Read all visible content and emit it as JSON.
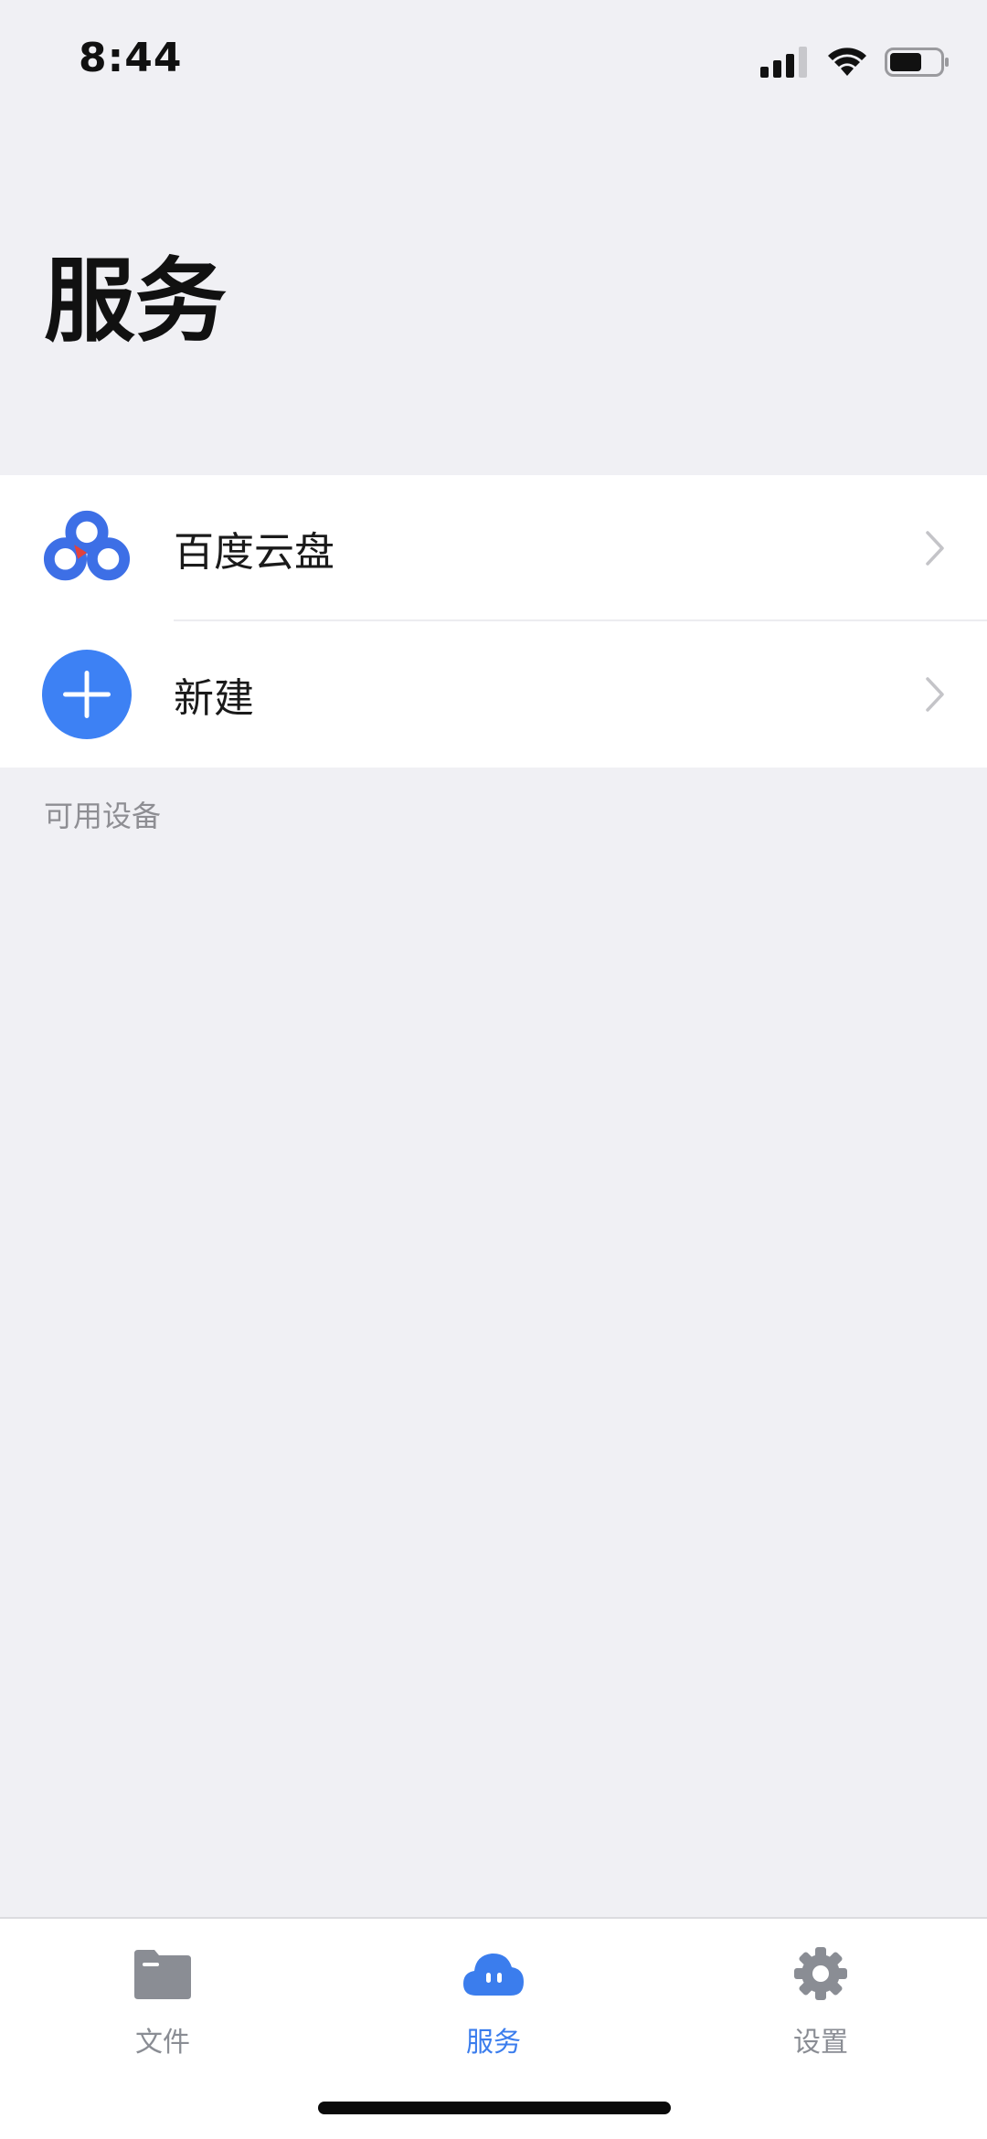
{
  "status_bar": {
    "time": "8:44"
  },
  "header": {
    "title": "服务"
  },
  "list": {
    "items": [
      {
        "label": "百度云盘",
        "icon": "baidu-cloud-icon"
      },
      {
        "label": "新建",
        "icon": "plus-circle-icon"
      }
    ]
  },
  "sections": {
    "available_devices": "可用设备"
  },
  "tab_bar": {
    "tabs": [
      {
        "label": "文件",
        "icon": "folder-icon"
      },
      {
        "label": "服务",
        "icon": "cloud-icon",
        "active": true
      },
      {
        "label": "设置",
        "icon": "gear-icon"
      }
    ]
  },
  "colors": {
    "accent": "#3b7ded",
    "background": "#f0f0f4",
    "inactive_tab": "#8a8d94"
  }
}
